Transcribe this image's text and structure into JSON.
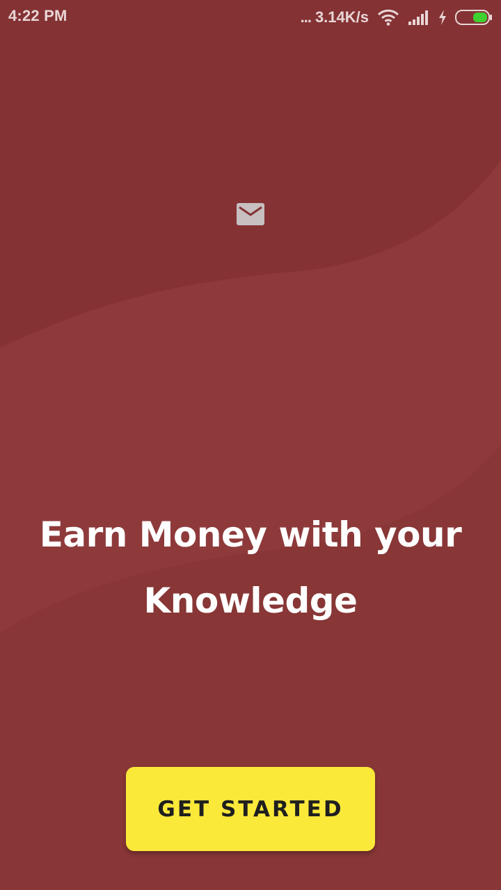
{
  "status_bar": {
    "time": "4:22 PM",
    "dots": "...",
    "network_speed": "3.14K/s",
    "icons": [
      "wifi-icon",
      "signal-icon",
      "charging-icon",
      "battery-icon"
    ],
    "battery_color": "#3fd12f"
  },
  "hero": {
    "icon": "mail-icon",
    "headline": "Earn Money with your Knowledge"
  },
  "cta": {
    "label": "GET STARTED"
  },
  "colors": {
    "background": "#843234",
    "wave_highlight": "#8f3c3d",
    "button": "#fbe93a",
    "button_text": "#1f1f1f",
    "headline_text": "#ffffff"
  }
}
